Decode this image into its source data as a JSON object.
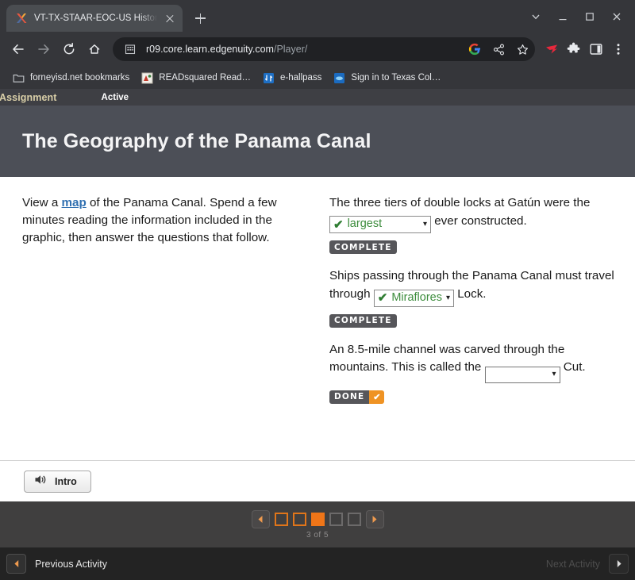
{
  "browser": {
    "tab": {
      "title": "VT-TX-STAAR-EOC-US History - In",
      "favicon": "edgenuity-x-icon",
      "close": "close-icon"
    },
    "new_tab": "new-tab-icon",
    "window_controls": [
      "chevron-down-icon",
      "minimize-icon",
      "maximize-icon",
      "close-window-icon"
    ],
    "nav": {
      "back": "back-arrow-icon",
      "forward": "forward-arrow-icon",
      "reload": "reload-icon",
      "home": "home-icon"
    },
    "omnibox": {
      "site_icon": "site-info-icon",
      "url_strong": "r09.core.learn.edgenuity.com",
      "url_dim": "/Player/",
      "google_icon": "google-lens-icon",
      "share_icon": "share-icon",
      "bookmark_icon": "star-icon"
    },
    "extensions": [
      "extension-red-icon",
      "puzzle-piece-icon",
      "side-panel-icon",
      "three-dot-menu-icon"
    ],
    "bookmarks": [
      {
        "label": "forneyisd.net bookmarks",
        "icon": "folder-icon"
      },
      {
        "label": "READsquared Read…",
        "icon": "readsquared-icon"
      },
      {
        "label": "e-hallpass",
        "icon": "ehallpass-icon"
      },
      {
        "label": "Sign in to Texas Col…",
        "icon": "texas-college-icon"
      }
    ]
  },
  "player": {
    "status": {
      "assignment": "Assignment",
      "state": "Active"
    },
    "title": "The Geography of the Panama Canal",
    "left_column": {
      "intro_before": "View a ",
      "intro_link": "map",
      "intro_after": " of the Panama Canal. Spend a few minutes reading the information included in the graphic, then answer the questions that follow."
    },
    "questions": [
      {
        "text_before": "The three tiers of double locks at Gatún were the ",
        "select": {
          "value": "largest",
          "checked": true,
          "caret": "chevron-down-icon"
        },
        "text_after": " ever constructed.",
        "badge": {
          "word": "COMPLETE",
          "has_tick": false
        }
      },
      {
        "text_before": "Ships passing through the Panama Canal must travel through ",
        "select": {
          "value": "Miraflores",
          "checked": true,
          "caret": "chevron-down-icon"
        },
        "text_after": " Lock.",
        "badge": {
          "word": "COMPLETE",
          "has_tick": false
        }
      },
      {
        "text_before": "An 8.5-mile channel was carved through the mountains. This is called the ",
        "select": {
          "value": "",
          "checked": false,
          "caret": "chevron-down-icon"
        },
        "text_after": " Cut.",
        "badge": {
          "word": "DONE",
          "has_tick": true,
          "tick": "✔"
        }
      }
    ],
    "audio_button": {
      "label": "Intro",
      "icon": "speaker-icon"
    },
    "pager": {
      "prev_icon": "pager-left-arrow-icon",
      "next_icon": "pager-right-arrow-icon",
      "slides": [
        "seen",
        "seen",
        "current",
        "unseen",
        "unseen"
      ],
      "count_label": "3 of 5"
    },
    "bottom_nav": {
      "previous": {
        "label": "Previous Activity",
        "icon": "left-arrow-icon",
        "disabled": false
      },
      "next": {
        "label": "Next Activity",
        "icon": "right-arrow-icon",
        "disabled": true
      }
    }
  },
  "colors": {
    "accent_orange": "#ef7518",
    "status_gold": "#d9cfa8",
    "link_blue": "#2f6fb0",
    "answer_green": "#3c8c3c",
    "chrome_bg": "#35363a"
  }
}
